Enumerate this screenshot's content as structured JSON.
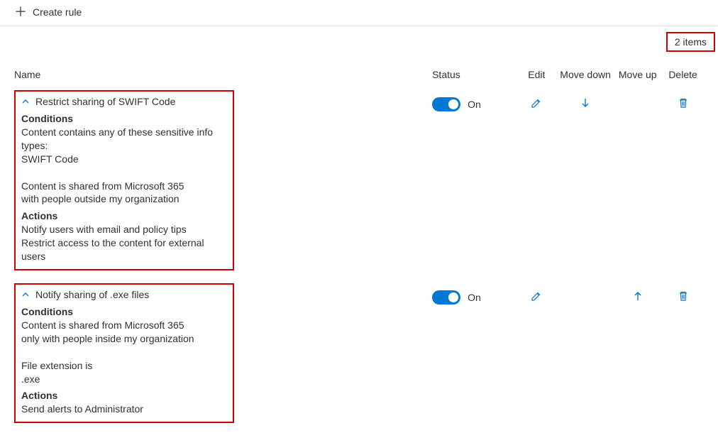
{
  "toolbar": {
    "create_label": "Create rule"
  },
  "items_count_label": "2 items",
  "headers": {
    "name": "Name",
    "status": "Status",
    "edit": "Edit",
    "move_down": "Move down",
    "move_up": "Move up",
    "delete": "Delete"
  },
  "rules": [
    {
      "title": "Restrict sharing of SWIFT Code",
      "status_label": "On",
      "show_move_down": true,
      "show_move_up": false,
      "sections": {
        "conditions_heading": "Conditions",
        "conditions_text": "Content contains any of these sensitive info types:\n    SWIFT Code\n\nContent is shared from Microsoft 365\n    with people outside my organization",
        "actions_heading": "Actions",
        "actions_text": "Notify users with email and policy tips\nRestrict access to the content for external users"
      }
    },
    {
      "title": "Notify sharing of .exe files",
      "status_label": "On",
      "show_move_down": false,
      "show_move_up": true,
      "sections": {
        "conditions_heading": "Conditions",
        "conditions_text": "Content is shared from Microsoft 365\n    only with people inside my organization\n\nFile extension is\n    .exe",
        "actions_heading": "Actions",
        "actions_text": "Send alerts to Administrator"
      }
    }
  ]
}
